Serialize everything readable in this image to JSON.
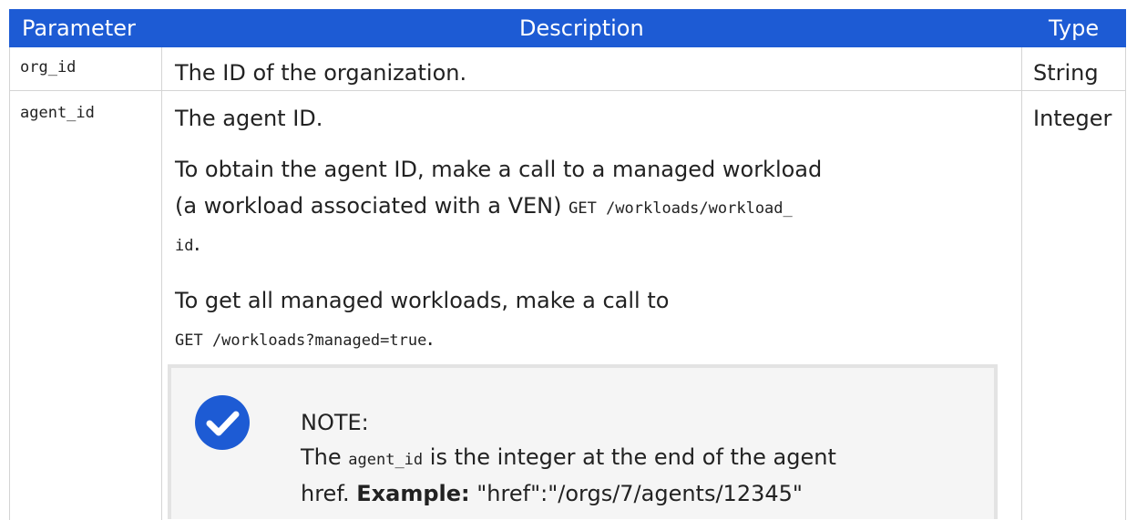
{
  "table": {
    "headers": [
      "Parameter",
      "Description",
      "Type"
    ],
    "rows": [
      {
        "parameter": "org_id",
        "description": "The ID of the organization.",
        "type": "String"
      },
      {
        "parameter": "agent_id",
        "type": "Integer",
        "description": {
          "line1": "The agent ID.",
          "para2_line1": "To obtain the agent ID, make a call to a managed workload",
          "para2_line2_text": "(a workload associated with a VEN) ",
          "para2_line2_code": "GET /workloads/workload_",
          "para2_line3_code": "id",
          "para2_line3_suffix": ".",
          "para3_line1": "To get all managed workloads, make a call to",
          "para3_line2_code": "GET /workloads?managed=true",
          "para3_line2_suffix": "."
        }
      }
    ]
  },
  "note": {
    "icon": "checkmark-circle-icon",
    "icon_color": "#1d5bd4",
    "title": "NOTE:",
    "line1_prefix": "The ",
    "line1_code": "agent_id",
    "line1_suffix": " is the integer at the end of the agent",
    "line2_prefix": "href. ",
    "line2_bold": "Example:",
    "line2_suffix": " \"href\":\"/orgs/7/agents/12345\""
  },
  "colors": {
    "header_bg": "#1d5bd4",
    "header_text": "#ffffff",
    "border": "#d4d4d4"
  }
}
